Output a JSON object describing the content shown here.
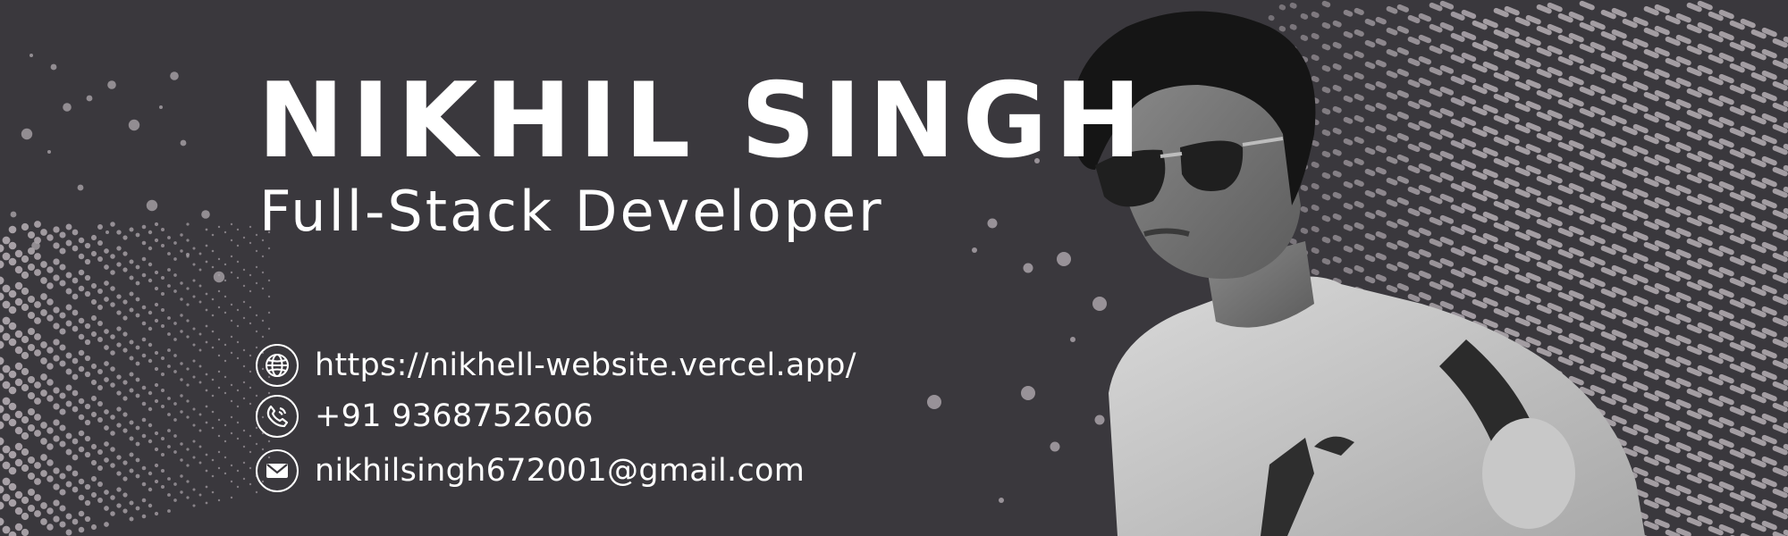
{
  "profile": {
    "name": "NIKHIL SINGH",
    "role": "Full-Stack Developer"
  },
  "contacts": {
    "website": {
      "icon": "globe-icon",
      "text": "https://nikhell-website.vercel.app/"
    },
    "phone": {
      "icon": "phone-icon",
      "text": "+91 9368752606"
    },
    "email": {
      "icon": "mail-icon",
      "text": "nikhilsingh672001@gmail.com"
    }
  },
  "colors": {
    "background": "#3a383d",
    "text": "#ffffff",
    "dots": "#a9a2a8"
  }
}
